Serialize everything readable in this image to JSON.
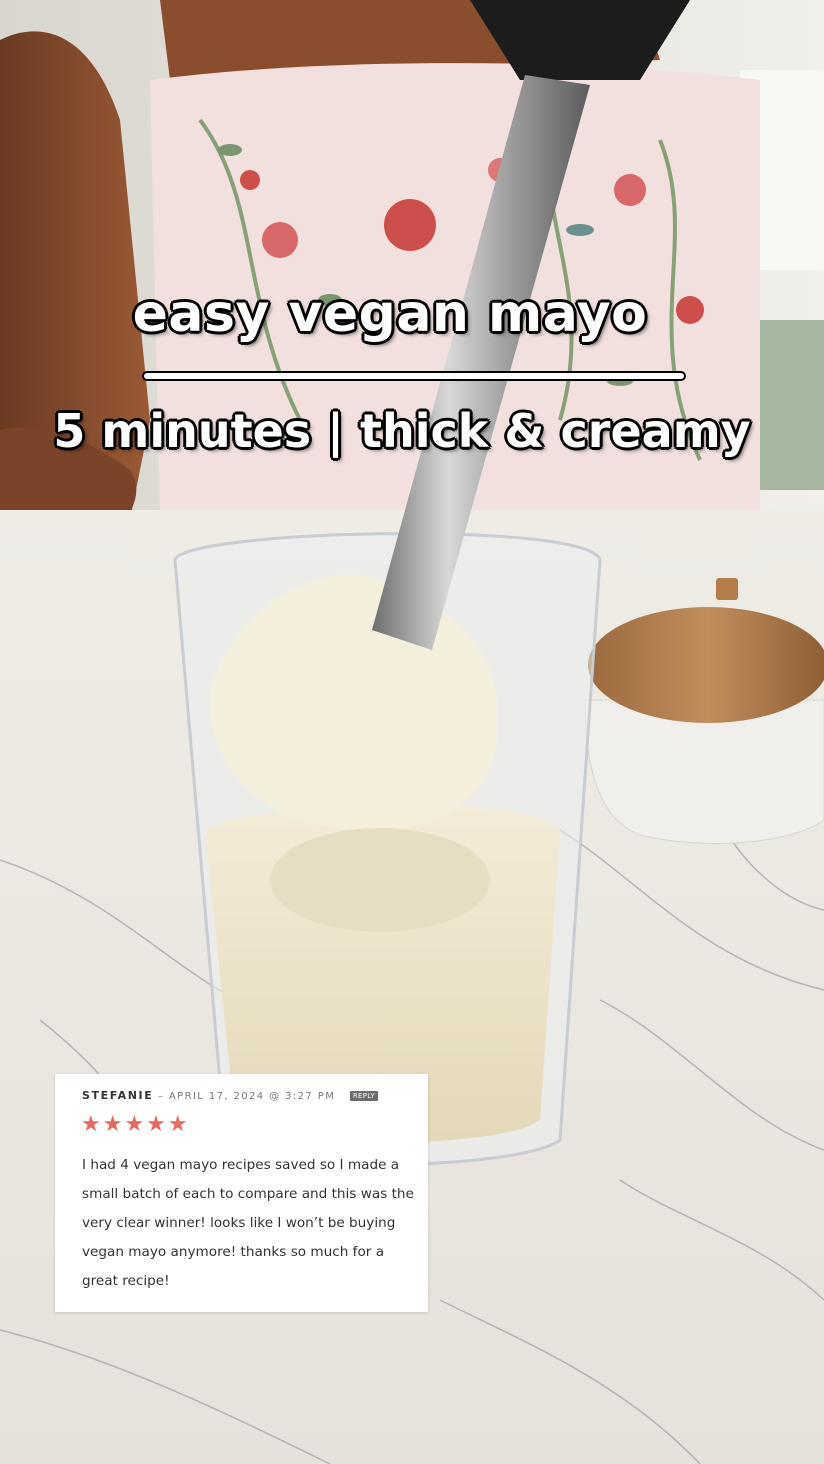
{
  "overlay": {
    "title": "easy vegan mayo",
    "subtitle": "5 minutes | thick & creamy"
  },
  "review": {
    "author": "STEFANIE",
    "separator": "–",
    "date": "APRIL 17, 2024 @ 3:27 PM",
    "reply_label": "REPLY",
    "rating": 5,
    "stars": "★★★★★",
    "body": "I had 4 vegan mayo recipes saved so I made a small batch of each to compare and this was the very clear winner! looks like I won’t be buying vegan mayo anymore! thanks so much for a great recipe!"
  },
  "colors": {
    "star": "#e46b62",
    "overlay_text": "#ffffff",
    "overlay_outline": "#000000",
    "countertop": "#e9e5de",
    "mayo": "#efe7cf"
  },
  "icons": [
    "star-icon"
  ]
}
